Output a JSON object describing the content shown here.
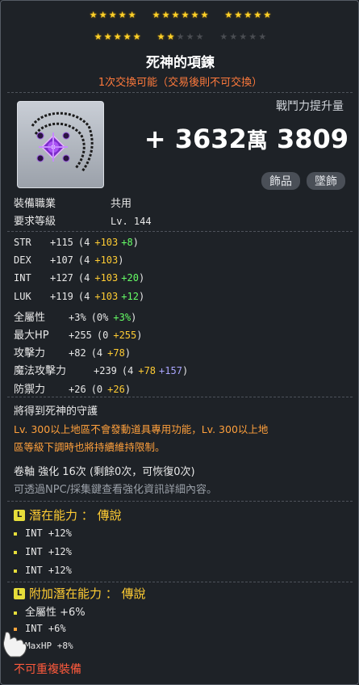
{
  "stars": {
    "row1": [
      5,
      6,
      5
    ],
    "row2_filled": [
      5,
      2,
      0
    ],
    "row2_total": [
      5,
      5,
      5
    ]
  },
  "item": {
    "title": "死神的項鍊",
    "trade_note": "1次交換可能（交易後則不可交換）",
    "cp_label": "戰鬥力提升量",
    "cp_prefix": "+ 3632",
    "cp_man": "萬",
    "cp_suffix": " 3809",
    "chips": [
      "飾品",
      "墜飾"
    ],
    "icon_name": "necklace-icon"
  },
  "reqs": [
    {
      "k": "裝備職業",
      "v": "共用"
    },
    {
      "k": "要求等級",
      "v": "Lv. 144"
    }
  ],
  "stats": [
    {
      "k": "STR",
      "total": "+115",
      "base": "(4",
      "add": "+103",
      "star": "+8",
      "starcolor": "g",
      "close": ")"
    },
    {
      "k": "DEX",
      "total": "+107",
      "base": "(4",
      "add": "+103",
      "star": "",
      "starcolor": "g",
      "close": ")"
    },
    {
      "k": "INT",
      "total": "+127",
      "base": "(4",
      "add": "+103",
      "star": "+20",
      "starcolor": "g",
      "close": ")"
    },
    {
      "k": "LUK",
      "total": "+119",
      "base": "(4",
      "add": "+103",
      "star": "+12",
      "starcolor": "g",
      "close": ")"
    },
    {
      "k": "全屬性",
      "total": "+3%",
      "base": "(0%",
      "add": "",
      "star": "+3%",
      "starcolor": "g",
      "close": ")"
    },
    {
      "k": "最大HP",
      "total": "+255",
      "base": "(0",
      "add": "+255",
      "star": "",
      "starcolor": "g",
      "close": ")"
    },
    {
      "k": "攻擊力",
      "total": "+82",
      "base": "(4",
      "add": "+78",
      "star": "",
      "starcolor": "g",
      "close": ")"
    },
    {
      "k": "魔法攻擊力",
      "total": "+239",
      "base": "(4",
      "add": "+78",
      "star": "+157",
      "starcolor": "p",
      "close": ")"
    },
    {
      "k": "防禦力",
      "total": "+26",
      "base": "(0",
      "add": "+26",
      "star": "",
      "starcolor": "g",
      "close": ")"
    }
  ],
  "set_note": "將得到死神的守護",
  "warning_line1": "Lv. 300以上地區不會發動道具專用功能，Lv. 300以上地",
  "warning_line2": "區等級下調時也將持續維持限制。",
  "scroll_line": "卷軸 強化 16次 (剩餘0次，可恢復0次)",
  "scroll_hint": "可透過NPC/採集鍵查看強化資訊詳細內容。",
  "potential": {
    "header": "潛在能力 ： 傳說",
    "badge": "L",
    "lines": [
      "INT +12%",
      "INT +12%",
      "INT +12%"
    ]
  },
  "additional": {
    "header": "附加潛在能力 ： 傳說",
    "badge": "L",
    "lines": [
      "全屬性 +6%",
      "INT +6%",
      "MaxHP +8%"
    ]
  },
  "footer": "不可重複裝備",
  "colors": {
    "gold": "#ffcc33",
    "green": "#66ff66",
    "purple": "#aaa6ff",
    "orange": "#ff7a3c",
    "red": "#ff5a3c"
  }
}
